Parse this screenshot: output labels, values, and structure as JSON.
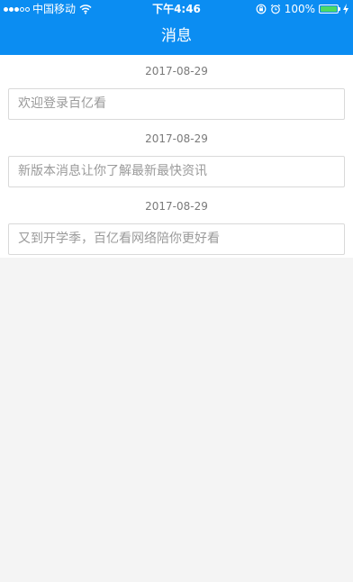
{
  "status_bar": {
    "carrier": "中国移动",
    "time": "下午4:46",
    "battery_percent": "100%",
    "battery_level": 1.0,
    "signal_filled": 3,
    "signal_total": 5
  },
  "nav": {
    "title": "消息"
  },
  "messages": [
    {
      "date": "2017-08-29",
      "text": "欢迎登录百亿看"
    },
    {
      "date": "2017-08-29",
      "text": "新版本消息让你了解最新最快资讯"
    },
    {
      "date": "2017-08-29",
      "text": "又到开学季，百亿看网络陪你更好看"
    }
  ],
  "colors": {
    "nav_background": "#0b8df2",
    "page_background": "#f4f4f4",
    "card_border": "#d9d9d9",
    "date_text": "#7a7a7a",
    "message_text": "#9a9a9a",
    "battery_fill": "#4cd964"
  },
  "icons": {
    "wifi": "wifi-icon",
    "orientation_lock": "orientation-lock-icon",
    "alarm": "alarm-icon",
    "charging": "charging-bolt-icon"
  }
}
